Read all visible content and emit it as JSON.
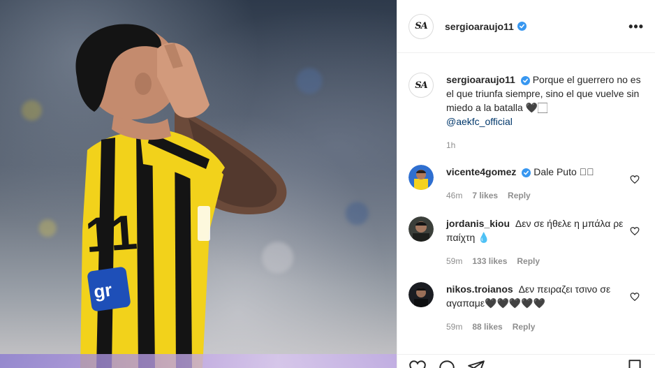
{
  "post": {
    "author": {
      "username": "sergioaraujo11",
      "verified": true,
      "avatar_text": "SA"
    },
    "more_icon": "more-horizontal-icon",
    "caption": {
      "username": "sergioaraujo11",
      "text": "Porque el guerrero no es el que triunfa siempre, sino el que vuelve sin miedo a la batalla 🖤🏻",
      "mention": "@aekfc_official",
      "time": "1h"
    },
    "comments": [
      {
        "username": "vicente4gomez",
        "verified": true,
        "text": "Dale Puto 🏻🏻",
        "time": "46m",
        "likes": "7 likes",
        "reply": "Reply"
      },
      {
        "username": "jordanis_kiou",
        "verified": false,
        "text": "Δεν σε ήθελε η μπάλα ρε παίχτη 💧",
        "time": "59m",
        "likes": "133 likes",
        "reply": "Reply"
      },
      {
        "username": "nikos.troianos",
        "verified": false,
        "text": "Δεν πειραζει τσινο σε αγαπαμε🖤🖤🖤🖤🖤",
        "time": "59m",
        "likes": "88 likes",
        "reply": "Reply"
      }
    ],
    "photo": {
      "jersey_sponsor": "gr",
      "jersey_number": "11"
    },
    "colors": {
      "verified": "#3897f0",
      "mention": "#00376b",
      "jersey_yellow": "#f2d21b",
      "jersey_black": "#141414"
    },
    "actions": [
      "heart-icon",
      "comment-icon",
      "share-icon",
      "bookmark-icon"
    ]
  }
}
